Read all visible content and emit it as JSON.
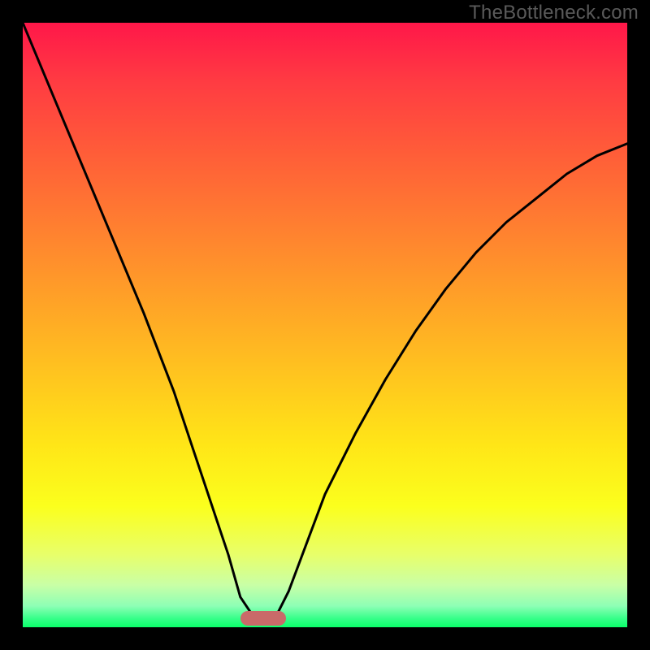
{
  "watermark": "TheBottleneck.com",
  "chart_data": {
    "type": "line",
    "title": "",
    "xlabel": "",
    "ylabel": "",
    "xlim": [
      0,
      100
    ],
    "ylim": [
      0,
      100
    ],
    "legend": false,
    "grid": false,
    "annotations": [
      {
        "name": "optimal-marker",
        "x_range": [
          36,
          43.5
        ],
        "y": 0
      }
    ],
    "series": [
      {
        "name": "bottleneck-curve",
        "x": [
          0,
          5,
          10,
          15,
          20,
          25,
          28,
          30,
          32,
          34,
          36,
          38,
          40,
          42,
          44,
          47,
          50,
          55,
          60,
          65,
          70,
          75,
          80,
          85,
          90,
          95,
          100
        ],
        "y": [
          100,
          88,
          76,
          64,
          52,
          39,
          30,
          24,
          18,
          12,
          5,
          2,
          0.5,
          2,
          6,
          14,
          22,
          32,
          41,
          49,
          56,
          62,
          67,
          71,
          75,
          78,
          80
        ]
      }
    ],
    "background_gradient_stops": [
      {
        "pos": 0,
        "color": "#ff1749"
      },
      {
        "pos": 0.1,
        "color": "#ff3c42"
      },
      {
        "pos": 0.22,
        "color": "#ff5e38"
      },
      {
        "pos": 0.34,
        "color": "#ff8030"
      },
      {
        "pos": 0.46,
        "color": "#ffa227"
      },
      {
        "pos": 0.58,
        "color": "#ffc41f"
      },
      {
        "pos": 0.7,
        "color": "#ffe617"
      },
      {
        "pos": 0.8,
        "color": "#fbff1d"
      },
      {
        "pos": 0.88,
        "color": "#e8ff6a"
      },
      {
        "pos": 0.93,
        "color": "#c9ffa6"
      },
      {
        "pos": 0.965,
        "color": "#8dffb5"
      },
      {
        "pos": 0.985,
        "color": "#38ff8a"
      },
      {
        "pos": 1.0,
        "color": "#0aff6a"
      }
    ]
  }
}
